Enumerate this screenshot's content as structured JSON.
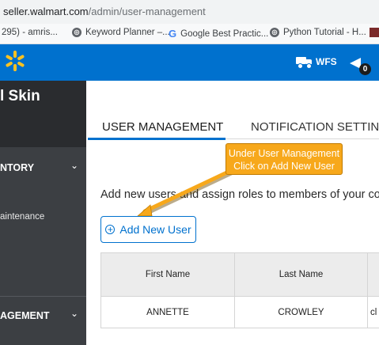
{
  "browser": {
    "url_host": "seller.walmart.com",
    "url_path": "/admin/user-management",
    "bookmarks": [
      {
        "label": "295) - amris...",
        "icon": "bookmark-page-icon"
      },
      {
        "label": "Keyword Planner –...",
        "icon": "globe-icon"
      },
      {
        "label": "Google Best Practic...",
        "icon": "google-g-icon"
      },
      {
        "label": "Python Tutorial - H...",
        "icon": "globe-icon"
      }
    ]
  },
  "topbar": {
    "wfs_label": "WFS",
    "notification_count": "0",
    "brand_color": "#0071ce",
    "spark_color": "#ffc220"
  },
  "sidebar": {
    "header": "l Skin",
    "items": [
      {
        "label": "NTORY",
        "chevron": "⌄"
      },
      {
        "label": "aintenance"
      },
      {
        "label": "AGEMENT",
        "chevron": "⌄"
      }
    ]
  },
  "main": {
    "tabs": [
      {
        "label": "USER MANAGEMENT",
        "active": true
      },
      {
        "label": "NOTIFICATION SETTIN",
        "active": false
      }
    ],
    "description": "Add new users and assign roles to members of your com",
    "add_button": "Add New User",
    "callout": {
      "line1": "Under User Management",
      "line2": "Click on Add New User",
      "color": "#f7a81b"
    },
    "table": {
      "headers": [
        "First Name",
        "Last Name",
        ""
      ],
      "rows": [
        [
          "ANNETTE",
          "CROWLEY",
          "cl"
        ]
      ]
    }
  }
}
